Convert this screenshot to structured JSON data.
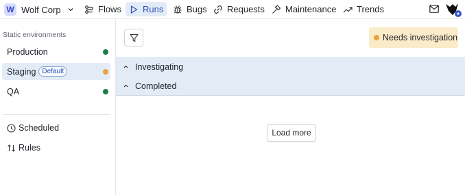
{
  "org": {
    "initial": "W",
    "name": "Wolf Corp"
  },
  "nav": [
    {
      "label": "Flows",
      "icon": "flows-icon",
      "active": false
    },
    {
      "label": "Runs",
      "icon": "play-icon",
      "active": true
    },
    {
      "label": "Bugs",
      "icon": "bug-icon",
      "active": false
    },
    {
      "label": "Requests",
      "icon": "link-icon",
      "active": false
    },
    {
      "label": "Maintenance",
      "icon": "hammer-icon",
      "active": false
    },
    {
      "label": "Trends",
      "icon": "trend-icon",
      "active": false
    }
  ],
  "header_icons": [
    "mail-icon",
    "avatar"
  ],
  "sidebar": {
    "heading": "Static environments",
    "environments": [
      {
        "label": "Production",
        "status_color": "#1a7f43"
      },
      {
        "label": "Staging",
        "badge": "Default",
        "status_color": "#e9a23b",
        "selected": true
      },
      {
        "label": "QA",
        "status_color": "#1a7f43"
      }
    ],
    "links": [
      {
        "label": "Scheduled",
        "icon": "clock-icon"
      },
      {
        "label": "Rules",
        "icon": "sort-arrows-icon"
      }
    ]
  },
  "main": {
    "filter_icon": "filter-icon",
    "status": {
      "label": "Needs investigation",
      "dot_color": "#e9a23b"
    },
    "groups": [
      {
        "label": "Investigating",
        "icon": "chevron-up-icon"
      },
      {
        "label": "Completed",
        "icon": "chevron-up-icon"
      }
    ],
    "load_more_label": "Load more"
  },
  "colors": {
    "accent": "#2f53b8",
    "selected_bg": "#e3ebf7",
    "warning_bg": "#faebc9"
  }
}
